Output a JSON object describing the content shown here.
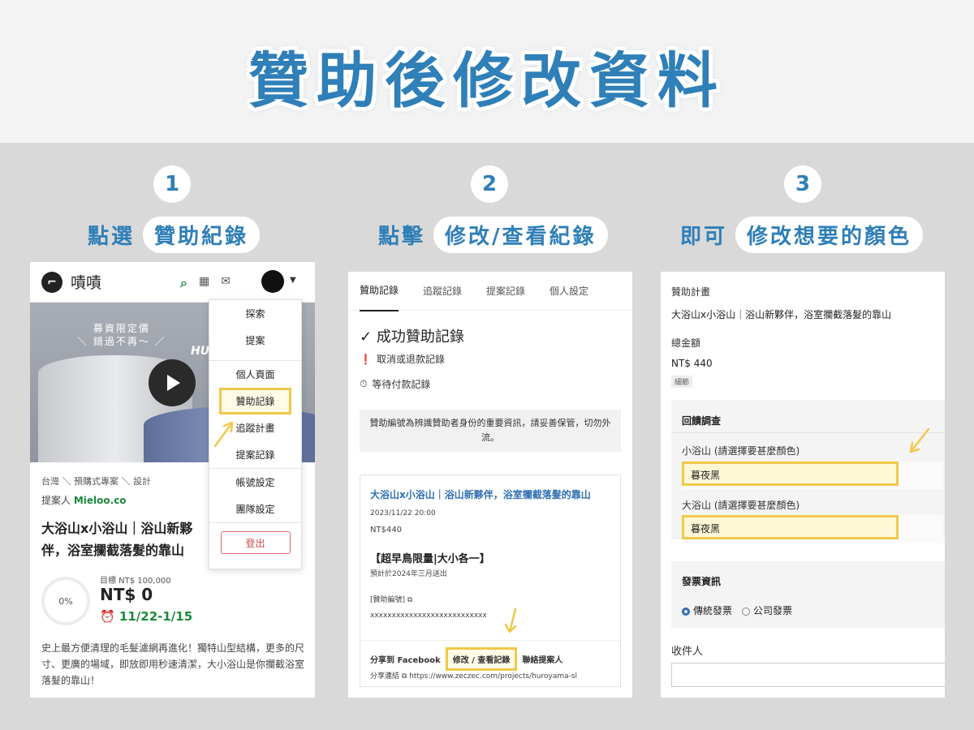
{
  "title": "贊助後修改資料",
  "steps": [
    {
      "num": "1",
      "verb": "點選",
      "target": "贊助紀錄"
    },
    {
      "num": "2",
      "verb": "點擊",
      "target": "修改/查看紀錄"
    },
    {
      "num": "3",
      "verb": "即可",
      "target": "修改想要的顏色"
    }
  ],
  "p1": {
    "brand": "嘖嘖",
    "hero_text": "募資限定價\n＼ 錯過不再～ ／",
    "hero_tag": "HU",
    "breadcrumb": "台灣 ＼ 預購式專案 ＼ 設計",
    "proposer_label": "提案人",
    "proposer_name": "Mieloo.co",
    "project_title": "大浴山x小浴山｜浴山新夥伴，浴室攔截落髮的靠山",
    "progress": "0%",
    "goal": "目標 NT$ 100,000",
    "amount": "NT$ 0",
    "dates": "11/22-1/15",
    "description": "史上最方便清理的毛髮濾網再進化！獨特山型結構，更多的尺寸、更廣的場域，即放即用秒速清潔，大小浴山是你攔截浴室落髮的靠山！",
    "menu": [
      "探索",
      "提案",
      "個人頁面",
      "贊助記錄",
      "追蹤計畫",
      "提案記錄",
      "帳號設定",
      "團隊設定"
    ],
    "logout": "登出"
  },
  "p2": {
    "tabs": [
      "贊助記錄",
      "追蹤記錄",
      "提案記錄",
      "個人設定"
    ],
    "success": "成功贊助記錄",
    "cancel": "取消或退款記錄",
    "pending": "等待付款記錄",
    "notice": "贊助編號為辨識贊助者身份的重要資訊，請妥善保管，切勿外流。",
    "card_title": "大浴山x小浴山｜浴山新夥伴，浴室攔截落髮的靠山",
    "date": "2023/11/22 20:00",
    "price": "NT$440",
    "reward": "【超早鳥限量|大小各一】",
    "ship": "預計於2024年三月送出",
    "id_label": "[贊助編號]",
    "id_value": "xxxxxxxxxxxxxxxxxxxxxxxxxxx",
    "share": "分享到 Facebook",
    "edit": "修改 / 查看記錄",
    "contact": "聯絡提案人",
    "share_link_label": "分享連結",
    "share_link": "https://www.zeczec.com/projects/huroyama-sl"
  },
  "p3": {
    "plan_label": "贊助計畫",
    "plan_value": "大浴山x小浴山｜浴山新夥伴，浴室攔截落髮的靠山",
    "total_label": "總金額",
    "total_value": "NT$ 440",
    "detail_tag": "細節",
    "survey": "回饋調查",
    "q1": "小浴山 (請選擇要甚麼顏色)",
    "a1": "暮夜黑",
    "q2": "大浴山 (請選擇要甚麼顏色)",
    "a2": "暮夜黑",
    "invoice": "發票資訊",
    "inv1": "傳統發票",
    "inv2": "公司發票",
    "receiver": "收件人"
  },
  "colors": {
    "accent": "#2f7fb8",
    "highlight": "#f1c84b",
    "green": "#1a8a3a"
  }
}
